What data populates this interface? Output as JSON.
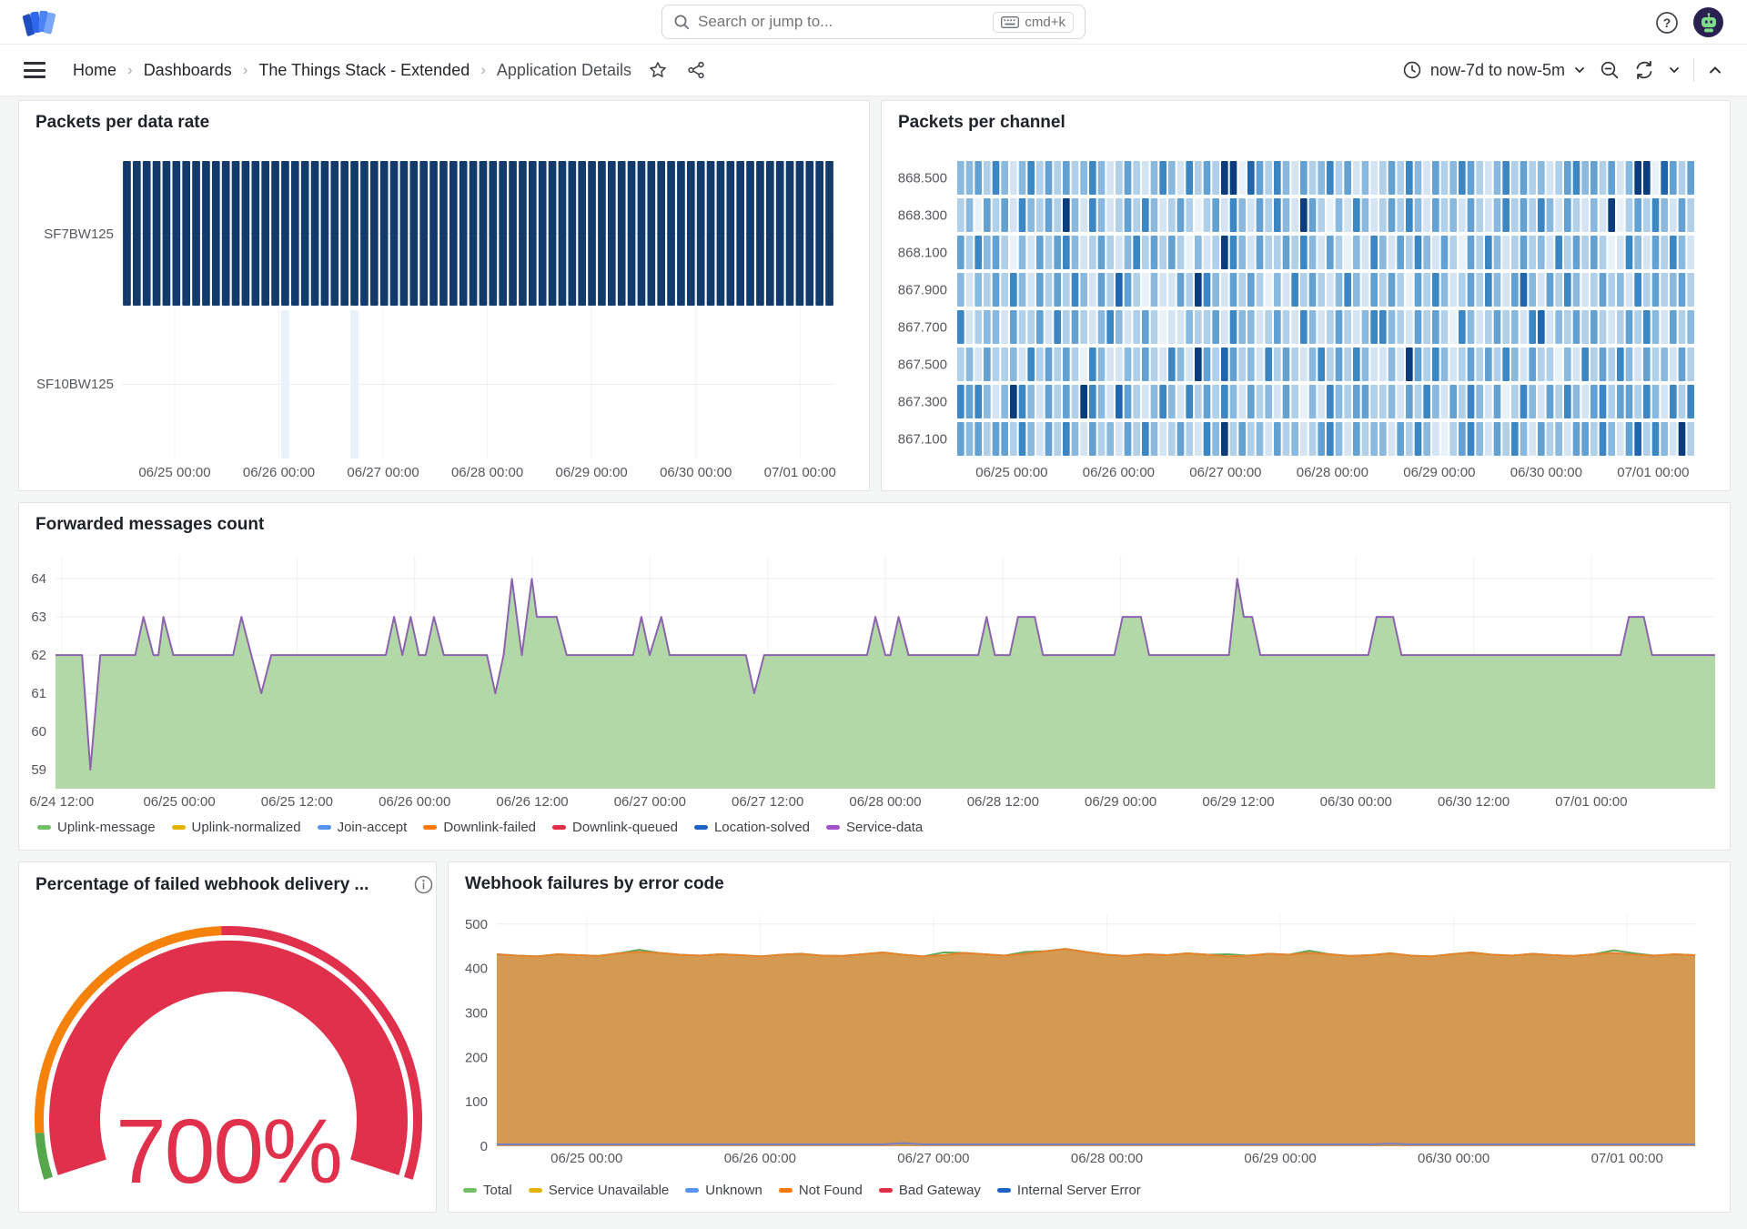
{
  "topbar": {
    "search_placeholder": "Search or jump to...",
    "shortcut": "cmd+k",
    "icons": {
      "logo": "grafana-logo",
      "search": "search-icon",
      "keyboard": "keyboard-icon",
      "help": "help-circle-icon",
      "avatar": "user-avatar"
    }
  },
  "toolbar": {
    "breadcrumb": [
      "Home",
      "Dashboards",
      "The Things Stack - Extended",
      "Application Details"
    ],
    "separator": "›",
    "time_range": "now-7d to now-5m",
    "icons": {
      "menu": "hamburger-icon",
      "star": "star-icon",
      "share": "share-icon",
      "clock": "clock-icon",
      "zoom_out": "zoom-out-icon",
      "refresh": "refresh-icon",
      "collapse": "chevron-up-icon"
    }
  },
  "chart_data": [
    {
      "type": "heatmap",
      "title": "Packets per data rate",
      "y_categories": [
        "SF7BW125",
        "SF10BW125"
      ],
      "x_ticks": [
        "06/25 00:00",
        "06/26 00:00",
        "06/27 00:00",
        "06/28 00:00",
        "06/29 00:00",
        "06/30 00:00",
        "07/01 00:00"
      ],
      "x0": 0.074,
      "xstep": 0.1463,
      "columns": 72,
      "rows": [
        {
          "name": "SF7BW125",
          "cells": "all"
        },
        {
          "name": "SF10BW125",
          "cells": [
            16,
            23
          ]
        }
      ],
      "cell_color": "#123a6b",
      "faint_cell_color": "#e9f1fa"
    },
    {
      "type": "heatmap",
      "title": "Packets per channel",
      "y_categories": [
        "868.500",
        "868.300",
        "868.100",
        "867.900",
        "867.700",
        "867.500",
        "867.300",
        "867.100"
      ],
      "x_ticks": [
        "06/25 00:00",
        "06/26 00:00",
        "06/27 00:00",
        "06/28 00:00",
        "06/29 00:00",
        "06/30 00:00",
        "07/01 00:00"
      ],
      "x0": 0.075,
      "xstep": 0.1447,
      "palette": [
        "#e9f1f9",
        "#d4e4f3",
        "#b0d0ea",
        "#8ab9df",
        "#62a1d2",
        "#3c86c3",
        "#1f66ac",
        "#0b3d7d"
      ],
      "rows": [
        "334253135242423531242135315242770642531423524131242531423542135242312453424137706424",
        "230424153242731531242531242024153142531742031531242531423142135242531421317024253142",
        "425342031424531242135242420312753142242531420315314253142042531242315242420153142531",
        "313242531424253142642031142753142420315242135314242042531242531463142531242315242342",
        "512331422415242135312420113224153312421531242135532142420531242315613242421242531423",
        "231422315242420531132421531742642315242135242531131742531242425314220315242531423142",
        "545313753142427531642135315242531423142031532442231425314253140253142531452442531525",
        "434244253142531423142531242153724231423124531423314253102453142531423144253146253172"
      ]
    },
    {
      "type": "area",
      "title": "Forwarded messages count",
      "x_ticks": [
        "6/24 12:00",
        "06/25 00:00",
        "06/25 12:00",
        "06/26 00:00",
        "06/26 12:00",
        "06/27 00:00",
        "06/27 12:00",
        "06/28 00:00",
        "06/28 12:00",
        "06/29 00:00",
        "06/29 12:00",
        "06/30 00:00",
        "06/30 12:00",
        "07/01 00:00"
      ],
      "x0": 0.0037,
      "xstep": 0.0709,
      "y_ticks": [
        59,
        60,
        61,
        62,
        63,
        64
      ],
      "y_range": [
        58.5,
        64.6
      ],
      "series": [
        {
          "name": "stack-top (Service-data over Uplink-message)",
          "line_color": "#8d62ae",
          "fill_color": "#b2d8a7",
          "width": 2,
          "points": [
            [
              0,
              62
            ],
            [
              0.016,
              62
            ],
            [
              0.021,
              59
            ],
            [
              0.027,
              62
            ],
            [
              0.048,
              62
            ],
            [
              0.053,
              63
            ],
            [
              0.059,
              62
            ],
            [
              0.062,
              62
            ],
            [
              0.065,
              63
            ],
            [
              0.071,
              62
            ],
            [
              0.107,
              62
            ],
            [
              0.112,
              63
            ],
            [
              0.118,
              62
            ],
            [
              0.124,
              61
            ],
            [
              0.13,
              62
            ],
            [
              0.199,
              62
            ],
            [
              0.204,
              63
            ],
            [
              0.209,
              62
            ],
            [
              0.214,
              63
            ],
            [
              0.219,
              62
            ],
            [
              0.223,
              62
            ],
            [
              0.228,
              63
            ],
            [
              0.234,
              62
            ],
            [
              0.26,
              62
            ],
            [
              0.265,
              61
            ],
            [
              0.27,
              62
            ],
            [
              0.275,
              64
            ],
            [
              0.281,
              62
            ],
            [
              0.287,
              64
            ],
            [
              0.29,
              63
            ],
            [
              0.302,
              63
            ],
            [
              0.308,
              62
            ],
            [
              0.348,
              62
            ],
            [
              0.353,
              63
            ],
            [
              0.358,
              62
            ],
            [
              0.365,
              63
            ],
            [
              0.37,
              62
            ],
            [
              0.416,
              62
            ],
            [
              0.421,
              61
            ],
            [
              0.427,
              62
            ],
            [
              0.489,
              62
            ],
            [
              0.494,
              63
            ],
            [
              0.5,
              62
            ],
            [
              0.503,
              62
            ],
            [
              0.508,
              63
            ],
            [
              0.514,
              62
            ],
            [
              0.556,
              62
            ],
            [
              0.561,
              63
            ],
            [
              0.566,
              62
            ],
            [
              0.575,
              62
            ],
            [
              0.58,
              63
            ],
            [
              0.59,
              63
            ],
            [
              0.595,
              62
            ],
            [
              0.638,
              62
            ],
            [
              0.643,
              63
            ],
            [
              0.654,
              63
            ],
            [
              0.659,
              62
            ],
            [
              0.707,
              62
            ],
            [
              0.712,
              64
            ],
            [
              0.716,
              63
            ],
            [
              0.721,
              63
            ],
            [
              0.726,
              62
            ],
            [
              0.791,
              62
            ],
            [
              0.796,
              63
            ],
            [
              0.806,
              63
            ],
            [
              0.811,
              62
            ],
            [
              0.943,
              62
            ],
            [
              0.948,
              63
            ],
            [
              0.957,
              63
            ],
            [
              0.962,
              62
            ],
            [
              1,
              62
            ]
          ]
        }
      ],
      "legend": [
        {
          "label": "Uplink-message",
          "color": "#73bf69"
        },
        {
          "label": "Uplink-normalized",
          "color": "#e0b400"
        },
        {
          "label": "Join-accept",
          "color": "#5794f2"
        },
        {
          "label": "Downlink-failed",
          "color": "#ff780a"
        },
        {
          "label": "Downlink-queued",
          "color": "#e02f44"
        },
        {
          "label": "Location-solved",
          "color": "#1f60c4"
        },
        {
          "label": "Service-data",
          "color": "#a352cc"
        }
      ]
    },
    {
      "type": "gauge",
      "title": "Percentage of failed webhook delivery ...",
      "value": 700,
      "unit": "%",
      "display_value": "700%",
      "min": 0,
      "max": 100,
      "value_color": "#e0304c",
      "thresholds": [
        {
          "color": "#56a64b",
          "from": 0,
          "to": 0.065
        },
        {
          "color": "#f5820b",
          "from": 0.065,
          "to": 0.49
        },
        {
          "color": "#e0304c",
          "from": 0.49,
          "to": 1
        }
      ]
    },
    {
      "type": "area",
      "title": "Webhook failures by error code",
      "x_ticks": [
        "06/25 00:00",
        "06/26 00:00",
        "06/27 00:00",
        "06/28 00:00",
        "06/29 00:00",
        "06/30 00:00",
        "07/01 00:00"
      ],
      "x0": 0.075,
      "xstep": 0.1447,
      "y_ticks": [
        0,
        100,
        200,
        300,
        400,
        500
      ],
      "y_range": [
        0,
        520
      ],
      "series": [
        {
          "name": "Total",
          "line_color": "#60a656",
          "width": 2,
          "values": [
            432,
            429,
            427,
            432,
            430,
            428,
            434,
            442,
            435,
            431,
            429,
            432,
            430,
            427,
            431,
            433,
            429,
            428,
            432,
            436,
            431,
            427,
            436,
            435,
            432,
            429,
            437,
            439,
            444,
            437,
            431,
            428,
            432,
            430,
            434,
            431,
            432,
            429,
            433,
            431,
            440,
            432,
            428,
            430,
            434,
            429,
            427,
            432,
            436,
            431,
            429,
            433,
            430,
            428,
            432,
            441,
            434,
            429,
            432,
            430
          ]
        },
        {
          "name": "Not Found",
          "line_color": "#e5832c",
          "fill_color": "#d49a52",
          "width": 2,
          "values": [
            432,
            429,
            427,
            432,
            430,
            428,
            434,
            437,
            435,
            431,
            429,
            432,
            430,
            427,
            431,
            433,
            429,
            428,
            432,
            436,
            431,
            427,
            430,
            435,
            432,
            429,
            433,
            439,
            444,
            437,
            431,
            428,
            432,
            430,
            434,
            431,
            427,
            429,
            433,
            431,
            435,
            432,
            428,
            430,
            434,
            429,
            427,
            432,
            436,
            431,
            429,
            433,
            430,
            428,
            432,
            435,
            431,
            429,
            432,
            430
          ]
        },
        {
          "name": "Internal Server Error / Bad Gateway",
          "line_color": "#7880c8",
          "width": 2,
          "values": [
            4,
            4,
            4,
            4,
            4,
            4,
            4,
            4,
            4,
            4,
            4,
            4,
            4,
            4,
            4,
            4,
            4,
            4,
            4,
            4,
            7,
            4,
            4,
            4,
            4,
            4,
            4,
            4,
            4,
            4,
            4,
            4,
            4,
            4,
            4,
            4,
            4,
            4,
            4,
            4,
            4,
            4,
            4,
            4,
            6,
            4,
            4,
            4,
            4,
            4,
            4,
            4,
            4,
            4,
            4,
            4,
            4,
            4,
            4,
            4
          ]
        }
      ],
      "legend": [
        {
          "label": "Total",
          "color": "#73bf69"
        },
        {
          "label": "Service Unavailable",
          "color": "#e0b400"
        },
        {
          "label": "Unknown",
          "color": "#5794f2"
        },
        {
          "label": "Not Found",
          "color": "#ff780a"
        },
        {
          "label": "Bad Gateway",
          "color": "#e02f44"
        },
        {
          "label": "Internal Server Error",
          "color": "#1f60c4"
        }
      ]
    }
  ]
}
